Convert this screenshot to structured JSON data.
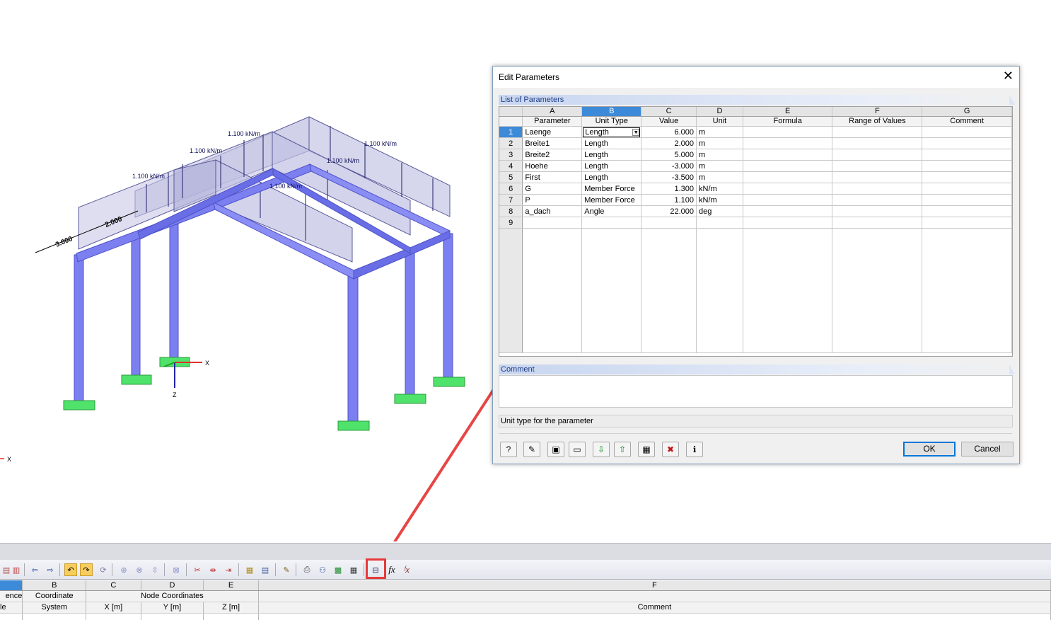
{
  "viewport": {
    "loads": [
      "1.100 kN/m",
      "1.100 kN/m",
      "1.100 kN/m",
      "1.100 kN/m",
      "1.100 kN/m",
      "1.100 kN/m"
    ],
    "dimensions": [
      "3.000",
      "2.000"
    ],
    "axes": {
      "x": "X",
      "z": "Z",
      "global_x": "X"
    },
    "colors": {
      "member": "#7b7ff0",
      "member_dark": "#4e52c8",
      "support": "#4fe36b",
      "load_fill": "#c6c6e4",
      "load_line": "#23236a",
      "arrow": "#e84545"
    }
  },
  "dialog": {
    "title": "Edit Parameters",
    "close_icon": "close-icon",
    "list_header": "List of Parameters",
    "columns": [
      {
        "letter": "A",
        "label": "Parameter"
      },
      {
        "letter": "B",
        "label": "Unit Type"
      },
      {
        "letter": "C",
        "label": "Value"
      },
      {
        "letter": "D",
        "label": "Unit"
      },
      {
        "letter": "E",
        "label": "Formula"
      },
      {
        "letter": "F",
        "label": "Range of Values"
      },
      {
        "letter": "G",
        "label": "Comment"
      }
    ],
    "rows": [
      {
        "no": "1",
        "parameter": "Laenge",
        "unit_type": "Length",
        "value": "6.000",
        "unit": "m"
      },
      {
        "no": "2",
        "parameter": "Breite1",
        "unit_type": "Length",
        "value": "2.000",
        "unit": "m"
      },
      {
        "no": "3",
        "parameter": "Breite2",
        "unit_type": "Length",
        "value": "5.000",
        "unit": "m"
      },
      {
        "no": "4",
        "parameter": "Hoehe",
        "unit_type": "Length",
        "value": "-3.000",
        "unit": "m"
      },
      {
        "no": "5",
        "parameter": "First",
        "unit_type": "Length",
        "value": "-3.500",
        "unit": "m"
      },
      {
        "no": "6",
        "parameter": "G",
        "unit_type": "Member Force",
        "value": "1.300",
        "unit": "kN/m"
      },
      {
        "no": "7",
        "parameter": "P",
        "unit_type": "Member Force",
        "value": "1.100",
        "unit": "kN/m"
      },
      {
        "no": "8",
        "parameter": "a_dach",
        "unit_type": "Angle",
        "value": "22.000",
        "unit": "deg"
      },
      {
        "no": "9",
        "parameter": "",
        "unit_type": "",
        "value": "",
        "unit": ""
      }
    ],
    "comment_header": "Comment",
    "status_text": "Unit type for the parameter",
    "tool_icons": [
      "help-icon",
      "edit-icon",
      "save-icon",
      "open-icon",
      "import-excel-icon",
      "export-icon",
      "calculator-icon",
      "delete-icon",
      "info-icon"
    ],
    "ok_label": "OK",
    "cancel_label": "Cancel"
  },
  "bottom_table": {
    "letters": [
      "",
      "B",
      "C",
      "D",
      "E",
      "F"
    ],
    "header_row1": [
      "ence",
      "Coordinate",
      "",
      "Node Coordinates",
      "",
      ""
    ],
    "header_row2": [
      "le",
      "System",
      "X [m]",
      "Y [m]",
      "Z [m]",
      "Comment"
    ]
  }
}
